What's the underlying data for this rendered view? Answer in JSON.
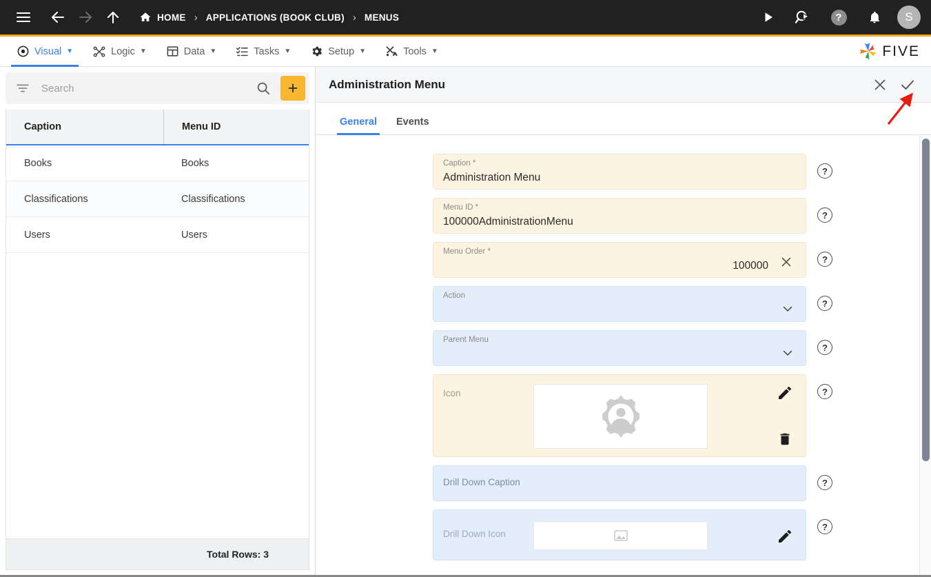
{
  "topbar": {
    "icons": [
      {
        "name": "hamburger-menu-icon"
      },
      {
        "name": "back-arrow-icon"
      },
      {
        "name": "forward-arrow-icon"
      },
      {
        "name": "up-arrow-icon"
      }
    ],
    "breadcrumbs": [
      {
        "label": "HOME",
        "icon": "home-icon"
      },
      {
        "label": "APPLICATIONS (BOOK CLUB)"
      },
      {
        "label": "MENUS"
      }
    ],
    "separator": "›",
    "actions": [
      {
        "name": "run-play-icon"
      },
      {
        "name": "debug-search-icon"
      },
      {
        "name": "help-icon",
        "label": "?"
      },
      {
        "name": "notifications-bell-icon"
      }
    ],
    "avatar_initial": "S"
  },
  "menubar": {
    "items": [
      {
        "label": "Visual",
        "icon": "eye-icon",
        "active": true
      },
      {
        "label": "Logic",
        "icon": "logic-nodes-icon",
        "active": false
      },
      {
        "label": "Data",
        "icon": "table-grid-icon",
        "active": false
      },
      {
        "label": "Tasks",
        "icon": "checklist-icon",
        "active": false
      },
      {
        "label": "Setup",
        "icon": "gear-icon",
        "active": false
      },
      {
        "label": "Tools",
        "icon": "tools-icon",
        "active": false
      }
    ],
    "caret": "▼",
    "logo_text": "FIVE"
  },
  "left_panel": {
    "filter_icon": "filter-icon",
    "search_placeholder": "Search",
    "search_value": "",
    "search_icon": "search-icon",
    "add_button_label": "+",
    "columns": [
      "Caption",
      "Menu ID"
    ],
    "rows": [
      {
        "caption": "Books",
        "menu_id": "Books"
      },
      {
        "caption": "Classifications",
        "menu_id": "Classifications"
      },
      {
        "caption": "Users",
        "menu_id": "Users"
      }
    ],
    "footer": "Total Rows: 3"
  },
  "right_panel": {
    "title": "Administration Menu",
    "close_icon": "close-x-icon",
    "confirm_icon": "checkmark-icon",
    "tabs": [
      {
        "label": "General",
        "active": true
      },
      {
        "label": "Events",
        "active": false
      }
    ],
    "fields": [
      {
        "label": "Caption *",
        "value": "Administration Menu",
        "type": "text",
        "style": "cream"
      },
      {
        "label": "Menu ID *",
        "value": "100000AdministrationMenu",
        "type": "text",
        "style": "cream"
      },
      {
        "label": "Menu Order *",
        "value": "100000",
        "type": "number",
        "style": "cream",
        "clear_icon": "clear-x-icon"
      },
      {
        "label": "Action",
        "value": "",
        "type": "dropdown",
        "style": "blue",
        "caret_icon": "chevron-down-icon"
      },
      {
        "label": "Parent Menu",
        "value": "",
        "type": "dropdown",
        "style": "blue",
        "caret_icon": "chevron-down-icon"
      },
      {
        "label": "Icon",
        "value": "",
        "type": "image",
        "style": "cream",
        "image_icon": "admin-gear-person-icon",
        "edit_icon": "pencil-icon",
        "delete_icon": "trash-icon"
      },
      {
        "label": "Drill Down Caption",
        "value": "",
        "type": "text",
        "style": "blue"
      },
      {
        "label": "Drill Down Icon",
        "value": "",
        "type": "image-small",
        "style": "blue",
        "image_icon": "image-placeholder-icon",
        "edit_icon": "pencil-icon"
      }
    ],
    "help_icon_label": "?"
  },
  "annotation": {
    "arrow": {
      "name": "red-arrow-annotation",
      "color": "#e81c0f",
      "points_to": "checkmark-icon"
    }
  },
  "colors": {
    "topbar_bg": "#212121",
    "accent_orange": "#f5a623",
    "accent_blue": "#3b82e8",
    "field_cream": "#fdf3e1",
    "field_blue": "#e3eefa",
    "add_button": "#f7b731"
  }
}
